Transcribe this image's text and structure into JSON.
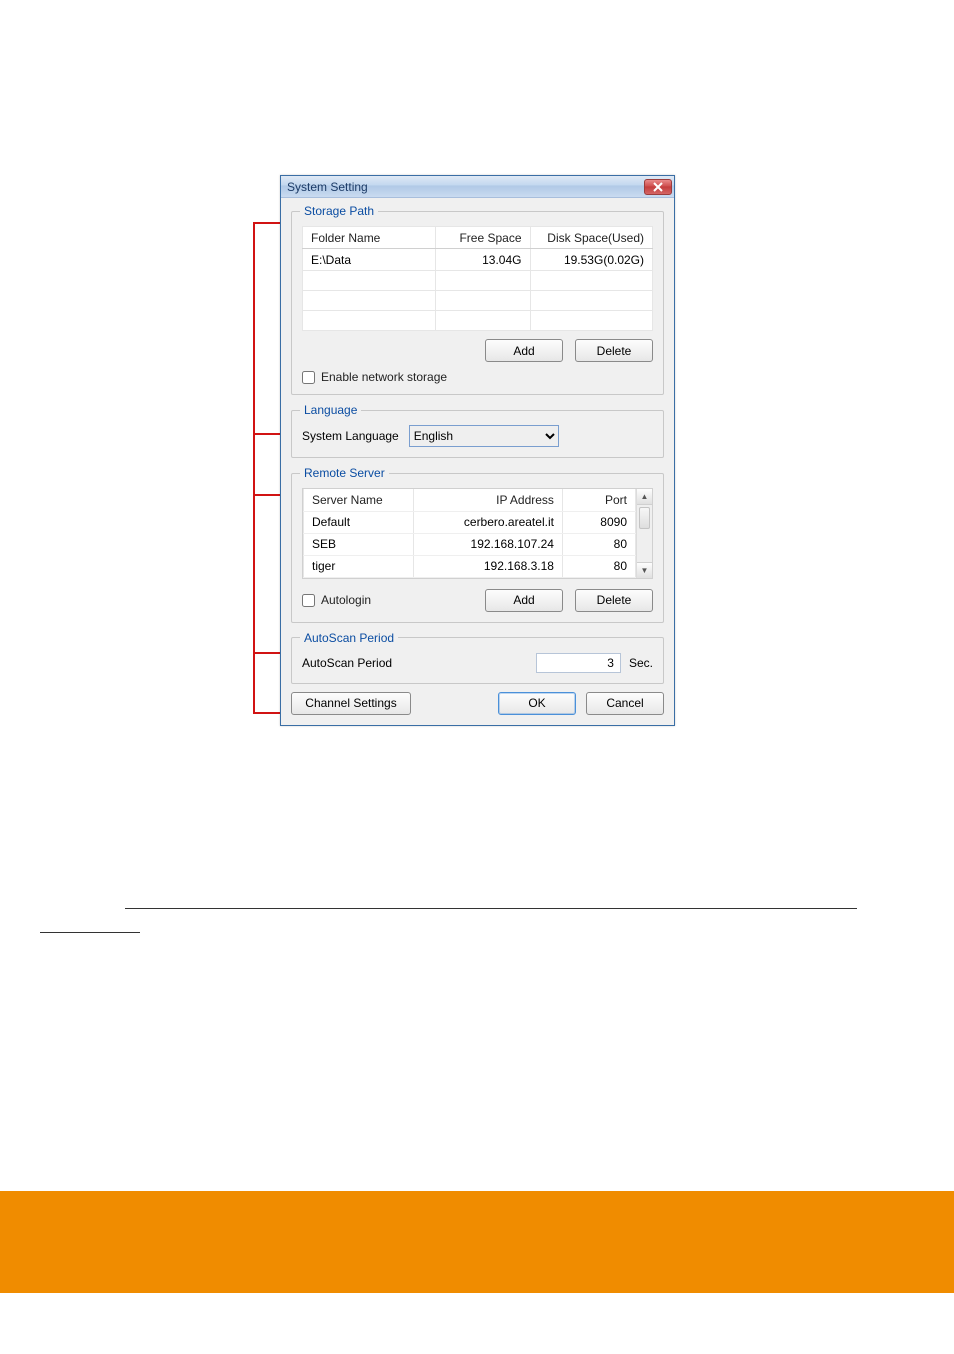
{
  "dialog": {
    "title": "System Setting",
    "storage": {
      "legend": "Storage Path",
      "columns": [
        "Folder Name",
        "Free Space",
        "Disk Space(Used)"
      ],
      "rows": [
        {
          "folder": "E:\\Data",
          "free": "13.04G",
          "disk": "19.53G(0.02G)"
        }
      ],
      "add": "Add",
      "delete": "Delete",
      "enable_network": "Enable network storage"
    },
    "language": {
      "legend": "Language",
      "label": "System Language",
      "value": "English"
    },
    "remote": {
      "legend": "Remote Server",
      "columns": [
        "Server Name",
        "IP Address",
        "Port"
      ],
      "rows": [
        {
          "name": "Default",
          "ip": "cerbero.areatel.it",
          "port": "8090"
        },
        {
          "name": "SEB",
          "ip": "192.168.107.24",
          "port": "80"
        },
        {
          "name": "tiger",
          "ip": "192.168.3.18",
          "port": "80"
        }
      ],
      "autologin": "Autologin",
      "add": "Add",
      "delete": "Delete"
    },
    "autoscan": {
      "legend": "AutoScan Period",
      "label": "AutoScan Period",
      "value": "3",
      "unit": "Sec."
    },
    "footer": {
      "channel": "Channel Settings",
      "ok": "OK",
      "cancel": "Cancel"
    }
  }
}
